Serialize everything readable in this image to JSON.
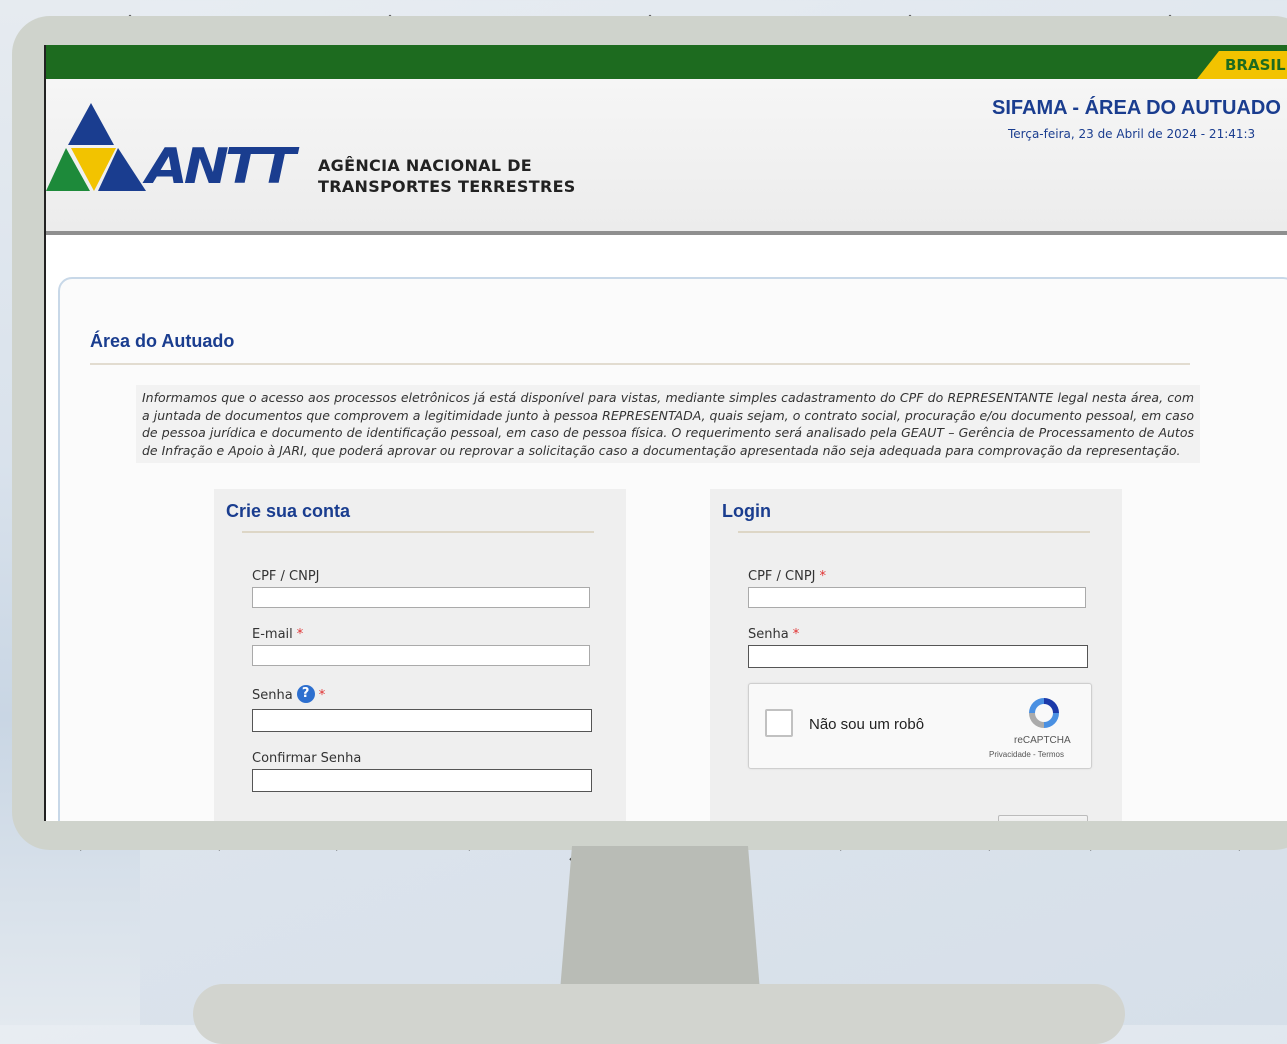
{
  "header": {
    "brasil_tag": "BRASIL",
    "system_title": "SIFAMA - ÁREA DO AUTUADO",
    "datetime": "Terça-feira, 23 de Abril de 2024 - 21:41:3",
    "logo_text": "ANTT",
    "agency_line1": "AGÊNCIA NACIONAL DE",
    "agency_line2": "TRANSPORTES TERRESTRES"
  },
  "main": {
    "section_title": "Área do Autuado",
    "notice": "Informamos que o acesso aos processos eletrônicos já está disponível para vistas, mediante simples cadastramento do CPF do REPRESENTANTE legal nesta área, com a juntada de documentos que comprovem a legitimidade junto à pessoa REPRESENTADA, quais sejam, o contrato social, procuração e/ou documento pessoal, em caso de pessoa jurídica e documento de identificação pessoal, em caso de pessoa física. O requerimento será analisado pela GEAUT – Gerência de Processamento de Autos de Infração e Apoio à JARI, que poderá aprovar ou reprovar a solicitação caso a documentação apresentada não seja adequada para comprovação da representação."
  },
  "register": {
    "title": "Crie sua conta",
    "cpf_label": "CPF / CNPJ",
    "cpf_value": "",
    "email_label": "E-mail",
    "email_value": "",
    "password_label": "Senha",
    "password_value": "",
    "confirm_label": "Confirmar Senha",
    "confirm_value": "",
    "required_mark": "*",
    "help_icon": "?"
  },
  "login": {
    "title": "Login",
    "cpf_label": "CPF / CNPJ",
    "cpf_value": "",
    "password_label": "Senha",
    "password_value": "",
    "required_mark": "*",
    "recaptcha_label": "Não sou um robô",
    "recaptcha_brand": "reCAPTCHA",
    "recaptcha_terms": "Privacidade - Termos"
  },
  "colors": {
    "gov_green": "#1d6b1f",
    "gov_yellow": "#f2c300",
    "title_blue": "#1a3d8f",
    "required_red": "#e03030"
  }
}
